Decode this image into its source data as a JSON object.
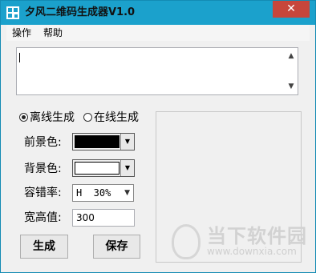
{
  "window": {
    "title": "夕风二维码生成器V1.0",
    "close_glyph": "✕"
  },
  "menu": {
    "items": [
      {
        "label": "操作"
      },
      {
        "label": "帮助"
      }
    ]
  },
  "textarea": {
    "value": ""
  },
  "mode": {
    "offline_label": "离线生成",
    "online_label": "在线生成",
    "selected": "offline"
  },
  "settings": {
    "foreground_label": "前景色:",
    "foreground_color": "#000000",
    "background_label": "背景色:",
    "background_color": "#ffffff",
    "error_label": "容错率:",
    "error_value": "H  30%",
    "size_label": "宽高值:",
    "size_value": "300"
  },
  "buttons": {
    "generate": "生成",
    "save": "保存"
  },
  "watermark": {
    "text": "当下软件园",
    "url": "www.downxia.com"
  }
}
